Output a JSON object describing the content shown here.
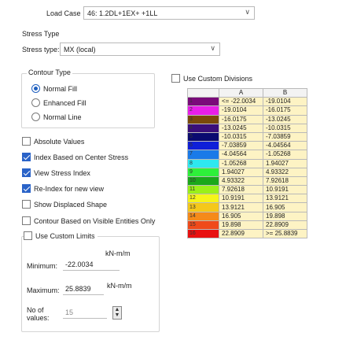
{
  "load_case": {
    "label": "Load Case",
    "value": "46: 1.2DL+1EX+ +1LL"
  },
  "stress_type": {
    "group_title": "Stress Type",
    "label": "Stress type:",
    "value": "MX (local)"
  },
  "contour_type": {
    "group_title": "Contour Type",
    "options": [
      {
        "label": "Normal Fill",
        "selected": true
      },
      {
        "label": "Enhanced Fill",
        "selected": false
      },
      {
        "label": "Normal Line",
        "selected": false
      }
    ]
  },
  "custom_divisions": {
    "label": "Use Custom Divisions",
    "checked": false
  },
  "checkboxes": [
    {
      "label": "Absolute Values",
      "checked": false
    },
    {
      "label": "Index Based on Center Stress",
      "checked": true
    },
    {
      "label": "View Stress Index",
      "checked": true
    },
    {
      "label": "Re-Index for new view",
      "checked": true
    },
    {
      "label": "Show Displaced Shape",
      "checked": false
    },
    {
      "label": "Contour Based on Visible Entities Only",
      "checked": false
    }
  ],
  "custom_limits": {
    "label": "Use Custom Limits",
    "checked": false,
    "minimum_label": "Minimum:",
    "minimum": "-22.0034",
    "minimum_unit": "kN-m/m",
    "maximum_label": "Maximum:",
    "maximum": "25.8839",
    "maximum_unit": "kN-m/m",
    "values_label_1": "No of",
    "values_label_2": "values:",
    "values": "15"
  },
  "table": {
    "col_a": "A",
    "col_b": "B",
    "rows": [
      {
        "n": "1",
        "color": "#7a0a7a",
        "a": "<= -22.0034",
        "b": "-19.0104"
      },
      {
        "n": "2",
        "color": "#e81fe8",
        "a": "-19.0104",
        "b": "-16.0175"
      },
      {
        "n": "3",
        "color": "#7a4a0a",
        "a": "-16.0175",
        "b": "-13.0245"
      },
      {
        "n": "4",
        "color": "#3a0f7a",
        "a": "-13.0245",
        "b": "-10.0315"
      },
      {
        "n": "5",
        "color": "#0a0a70",
        "a": "-10.0315",
        "b": "-7.03859"
      },
      {
        "n": "6",
        "color": "#0f1fd8",
        "a": "-7.03859",
        "b": "-4.04564"
      },
      {
        "n": "7",
        "color": "#1a7ae8",
        "a": "-4.04564",
        "b": "-1.05268"
      },
      {
        "n": "8",
        "color": "#2ee8f0",
        "a": "-1.05268",
        "b": "1.94027"
      },
      {
        "n": "9",
        "color": "#2ef03a",
        "a": "1.94027",
        "b": "4.93322"
      },
      {
        "n": "10",
        "color": "#1aa81a",
        "a": "4.93322",
        "b": "7.92618"
      },
      {
        "n": "11",
        "color": "#9af01a",
        "a": "7.92618",
        "b": "10.9191"
      },
      {
        "n": "12",
        "color": "#f5f51a",
        "a": "10.9191",
        "b": "13.9121"
      },
      {
        "n": "13",
        "color": "#f5c81a",
        "a": "13.9121",
        "b": "16.905"
      },
      {
        "n": "14",
        "color": "#f58a1a",
        "a": "16.905",
        "b": "19.898"
      },
      {
        "n": "15",
        "color": "#f04a1a",
        "a": "19.898",
        "b": "22.8909"
      },
      {
        "n": "16",
        "color": "#e81010",
        "a": "22.8909",
        "b": ">= 25.8839"
      }
    ]
  }
}
